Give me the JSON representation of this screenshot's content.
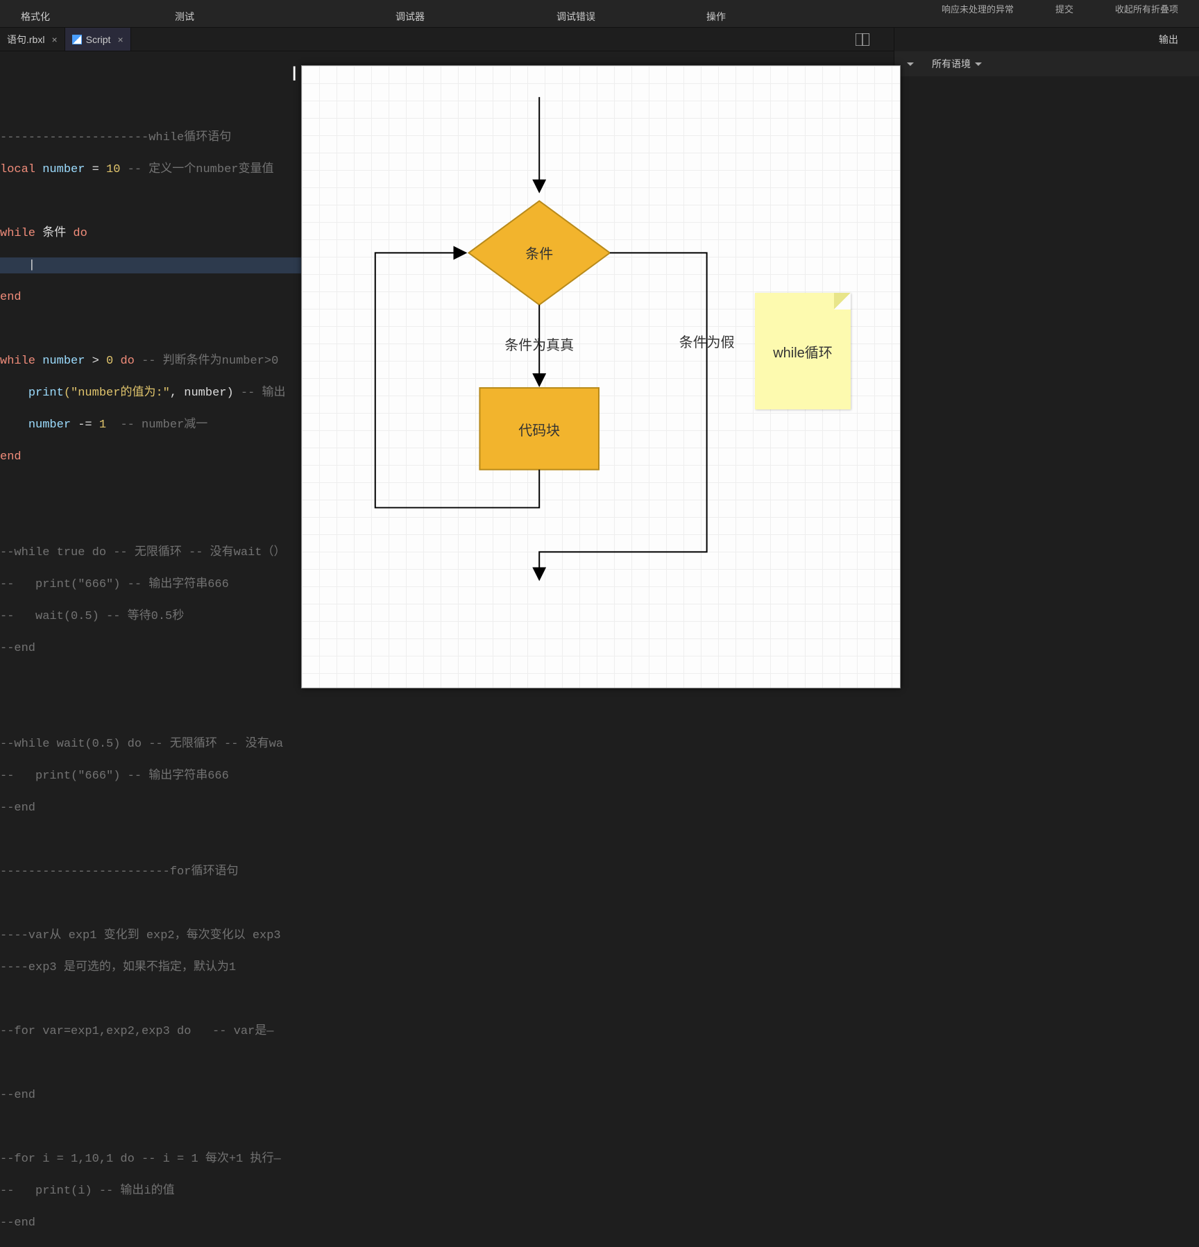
{
  "ribbon": {
    "format": "格式化",
    "test": "测试",
    "debugger": "调试器",
    "debug_error": "调试错误",
    "operation": "操作",
    "opt_unhandled": "响应未处理的异常",
    "opt_fold": "收起所有折叠项",
    "opt_raise": "提交"
  },
  "tabs": {
    "t1": "语句.rbxl",
    "t2": "Script"
  },
  "right_panel": {
    "output": "输出",
    "filter_all": "所有语境"
  },
  "code": {
    "l1_cm": "---------------------while循环语句",
    "l2a": "local",
    "l2b": "number",
    "l2c": "=",
    "l2d": "10",
    "l2e": "-- 定义一个number变量值",
    "l4a": "while",
    "l4b": "条件",
    "l4c": "do",
    "l5_cursor": "",
    "l6": "end",
    "l8a": "while",
    "l8b": "number",
    "l8c": ">",
    "l8d": "0",
    "l8e": "do",
    "l8f": "-- 判断条件为number>0",
    "l9a": "print",
    "l9b": "(\"number的值为:\"",
    "l9c": ", number)",
    "l9d": "-- 输出",
    "l10a": "number",
    "l10b": "-=",
    "l10c": "1",
    "l10d": "-- number减一",
    "l11": "end",
    "l13": "--while true do -- 无限循环 -- 没有wait（）",
    "l14": "--   print(\"666\") -- 输出字符串666",
    "l15": "--   wait(0.5) -- 等待0.5秒",
    "l16": "--end",
    "l18": "--while wait(0.5) do -- 无限循环 -- 没有wa",
    "l19": "--   print(\"666\") -- 输出字符串666",
    "l20": "--end",
    "l22": "------------------------for循环语句",
    "l24": "----var从 exp1 变化到 exp2，每次变化以 exp3",
    "l25": "----exp3 是可选的，如果不指定，默认为1",
    "l27": "--for var=exp1,exp2,exp3 do   -- var是—",
    "l29": "--end",
    "l31": "--for i = 1,10,1 do -- i = 1 每次+1 执行—",
    "l32": "--   print(i) -- 输出i的值",
    "l33": "--end"
  },
  "diagram": {
    "condition": "条件",
    "true_label": "条件为真真",
    "false_label": "条件为假",
    "code_block": "代码块",
    "note": "while循环"
  }
}
